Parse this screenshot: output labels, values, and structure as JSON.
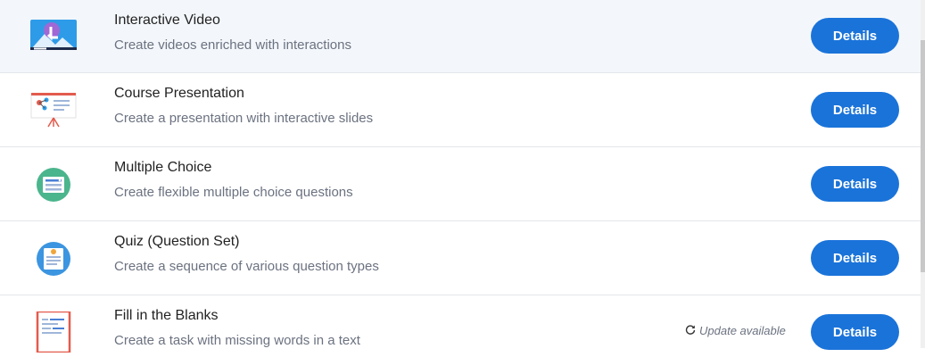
{
  "items": [
    {
      "title": "Interactive Video",
      "description": "Create videos enriched with interactions",
      "button": "Details",
      "icon": "interactive-video-icon"
    },
    {
      "title": "Course Presentation",
      "description": "Create a presentation with interactive slides",
      "button": "Details",
      "icon": "course-presentation-icon"
    },
    {
      "title": "Multiple Choice",
      "description": "Create flexible multiple choice questions",
      "button": "Details",
      "icon": "multiple-choice-icon"
    },
    {
      "title": "Quiz (Question Set)",
      "description": "Create a sequence of various question types",
      "button": "Details",
      "icon": "question-set-icon"
    },
    {
      "title": "Fill in the Blanks",
      "description": "Create a task with missing words in a text",
      "button": "Details",
      "icon": "fill-in-the-blanks-icon",
      "update_text": "Update available"
    }
  ],
  "colors": {
    "accent": "#1a73d9",
    "highlight_row": "#f3f7fb"
  }
}
